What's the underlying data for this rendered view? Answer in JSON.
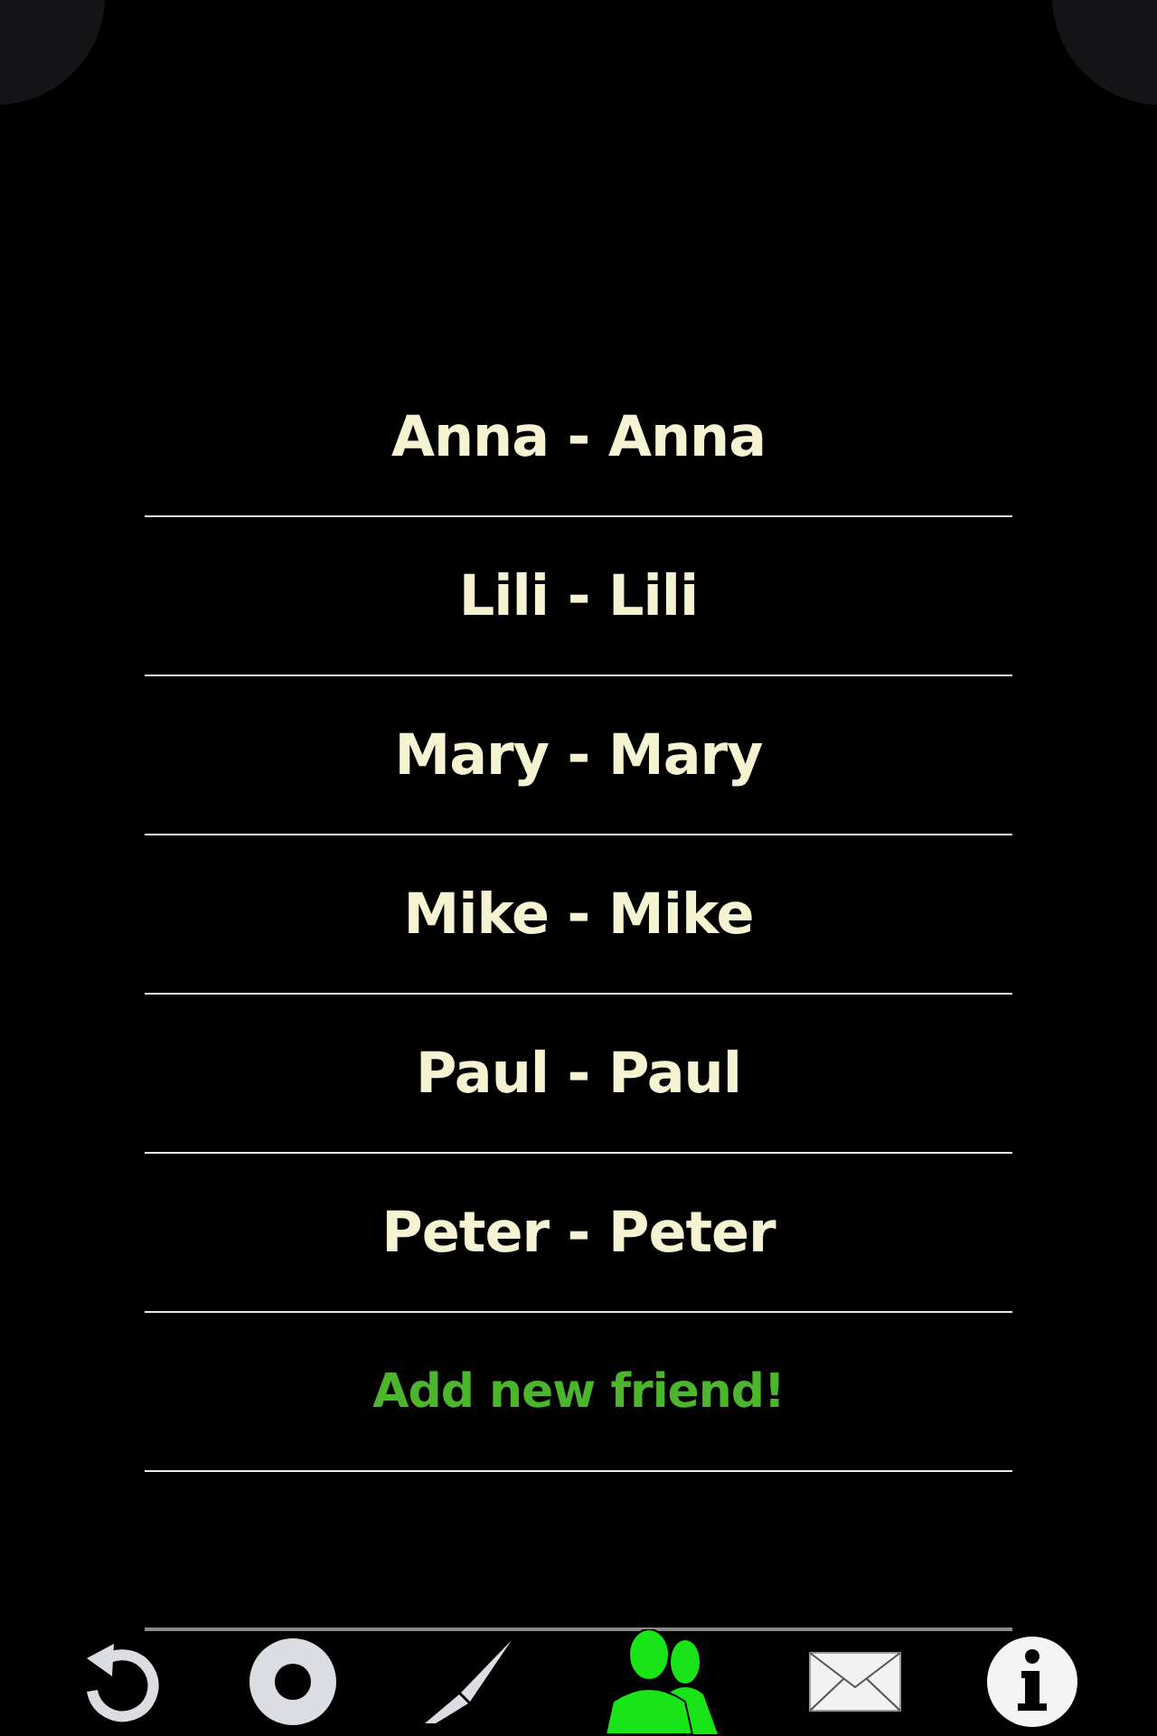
{
  "friends": [
    {
      "kind": "friend",
      "label": "Anna - Anna"
    },
    {
      "kind": "friend",
      "label": "Lili - Lili"
    },
    {
      "kind": "friend",
      "label": "Mary - Mary"
    },
    {
      "kind": "friend",
      "label": "Mike - Mike"
    },
    {
      "kind": "friend",
      "label": "Paul - Paul"
    },
    {
      "kind": "friend",
      "label": "Peter - Peter"
    },
    {
      "kind": "add",
      "label": "Add new friend!"
    }
  ],
  "toolbar": [
    {
      "kind": "undo",
      "selected": false
    },
    {
      "kind": "record",
      "selected": false
    },
    {
      "kind": "brush",
      "selected": false
    },
    {
      "kind": "friends",
      "selected": true
    },
    {
      "kind": "mail",
      "selected": false
    },
    {
      "kind": "info",
      "selected": false
    }
  ]
}
